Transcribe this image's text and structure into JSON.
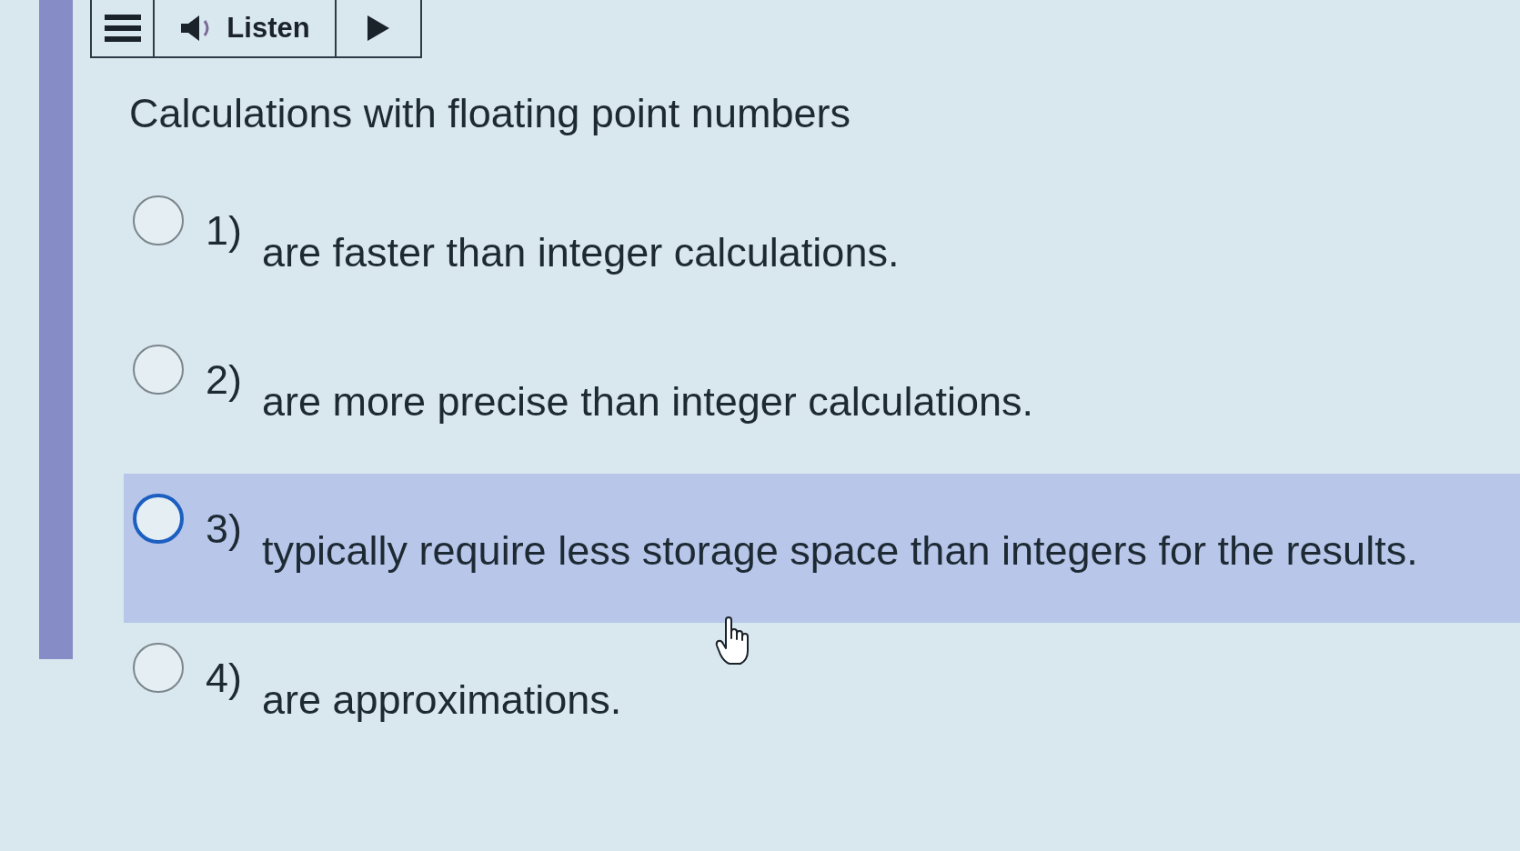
{
  "toolbar": {
    "listen_label": "Listen"
  },
  "question": {
    "prompt": "Calculations with floating point numbers",
    "options": [
      {
        "number": "1)",
        "text": "are faster than integer calculations.",
        "selected": false,
        "highlighted": false
      },
      {
        "number": "2)",
        "text": "are more precise than integer calculations.",
        "selected": false,
        "highlighted": false
      },
      {
        "number": "3)",
        "text": "typically require less storage space than integers for the results.",
        "selected": false,
        "highlighted": true
      },
      {
        "number": "4)",
        "text": "are approximations.",
        "selected": false,
        "highlighted": false
      }
    ]
  }
}
